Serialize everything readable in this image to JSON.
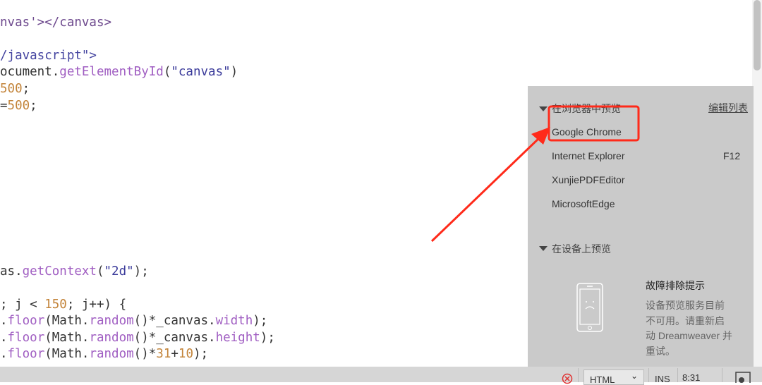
{
  "code_lines": [
    {
      "parts": [
        [
          "t",
          "nvas'></canvas>"
        ]
      ]
    },
    {
      "parts": [
        [
          "k",
          "/javascript\">"
        ]
      ]
    },
    {
      "parts": [
        [
          "d",
          "ocument."
        ],
        [
          "f",
          "getElementById"
        ],
        [
          "d",
          "("
        ],
        [
          "s",
          "\"canvas\""
        ],
        [
          "d",
          ")"
        ]
      ]
    },
    {
      "parts": [
        [
          "n",
          "500"
        ],
        [
          "d",
          ";"
        ]
      ]
    },
    {
      "parts": [
        [
          "d",
          "="
        ],
        [
          "n",
          "500"
        ],
        [
          "d",
          ";"
        ]
      ]
    },
    {
      "parts": [
        [
          "d",
          "as."
        ],
        [
          "f",
          "getContext"
        ],
        [
          "d",
          "("
        ],
        [
          "s",
          "\"2d\""
        ],
        [
          "d",
          ");"
        ]
      ]
    },
    {
      "parts": [
        [
          "d",
          "; j < "
        ],
        [
          "n",
          "150"
        ],
        [
          "d",
          "; j++) {"
        ]
      ]
    },
    {
      "parts": [
        [
          "d",
          "."
        ],
        [
          "f",
          "floor"
        ],
        [
          "d",
          "(Math."
        ],
        [
          "f",
          "random"
        ],
        [
          "d",
          "()*_canvas."
        ],
        [
          "f",
          "width"
        ],
        [
          "d",
          ");"
        ]
      ]
    },
    {
      "parts": [
        [
          "d",
          "."
        ],
        [
          "f",
          "floor"
        ],
        [
          "d",
          "(Math."
        ],
        [
          "f",
          "random"
        ],
        [
          "d",
          "()*_canvas."
        ],
        [
          "f",
          "height"
        ],
        [
          "d",
          ");"
        ]
      ]
    },
    {
      "parts": [
        [
          "d",
          "."
        ],
        [
          "f",
          "floor"
        ],
        [
          "d",
          "(Math."
        ],
        [
          "f",
          "random"
        ],
        [
          "d",
          "()*"
        ],
        [
          "n",
          "31"
        ],
        [
          "d",
          "+"
        ],
        [
          "n",
          "10"
        ],
        [
          "d",
          ");"
        ]
      ]
    }
  ],
  "preview_panel": {
    "browser_section_title": "在浏览器中预览",
    "edit_list_link": "编辑列表",
    "browsers": [
      {
        "name": "Google Chrome",
        "shortcut": ""
      },
      {
        "name": "Internet Explorer",
        "shortcut": "F12"
      },
      {
        "name": "XunjiePDFEditor",
        "shortcut": ""
      },
      {
        "name": "MicrosoftEdge",
        "shortcut": ""
      }
    ],
    "device_section_title": "在设备上预览",
    "troubleshoot_title": "故障排除提示",
    "troubleshoot_lines": [
      "设备预览服务目前",
      "不可用。请重新启",
      "动 Dreamweaver 并",
      "重试。"
    ]
  },
  "status_bar": {
    "language": "HTML",
    "mode": "INS",
    "position": "8:31"
  },
  "annotation_color": "#ff2a1a"
}
